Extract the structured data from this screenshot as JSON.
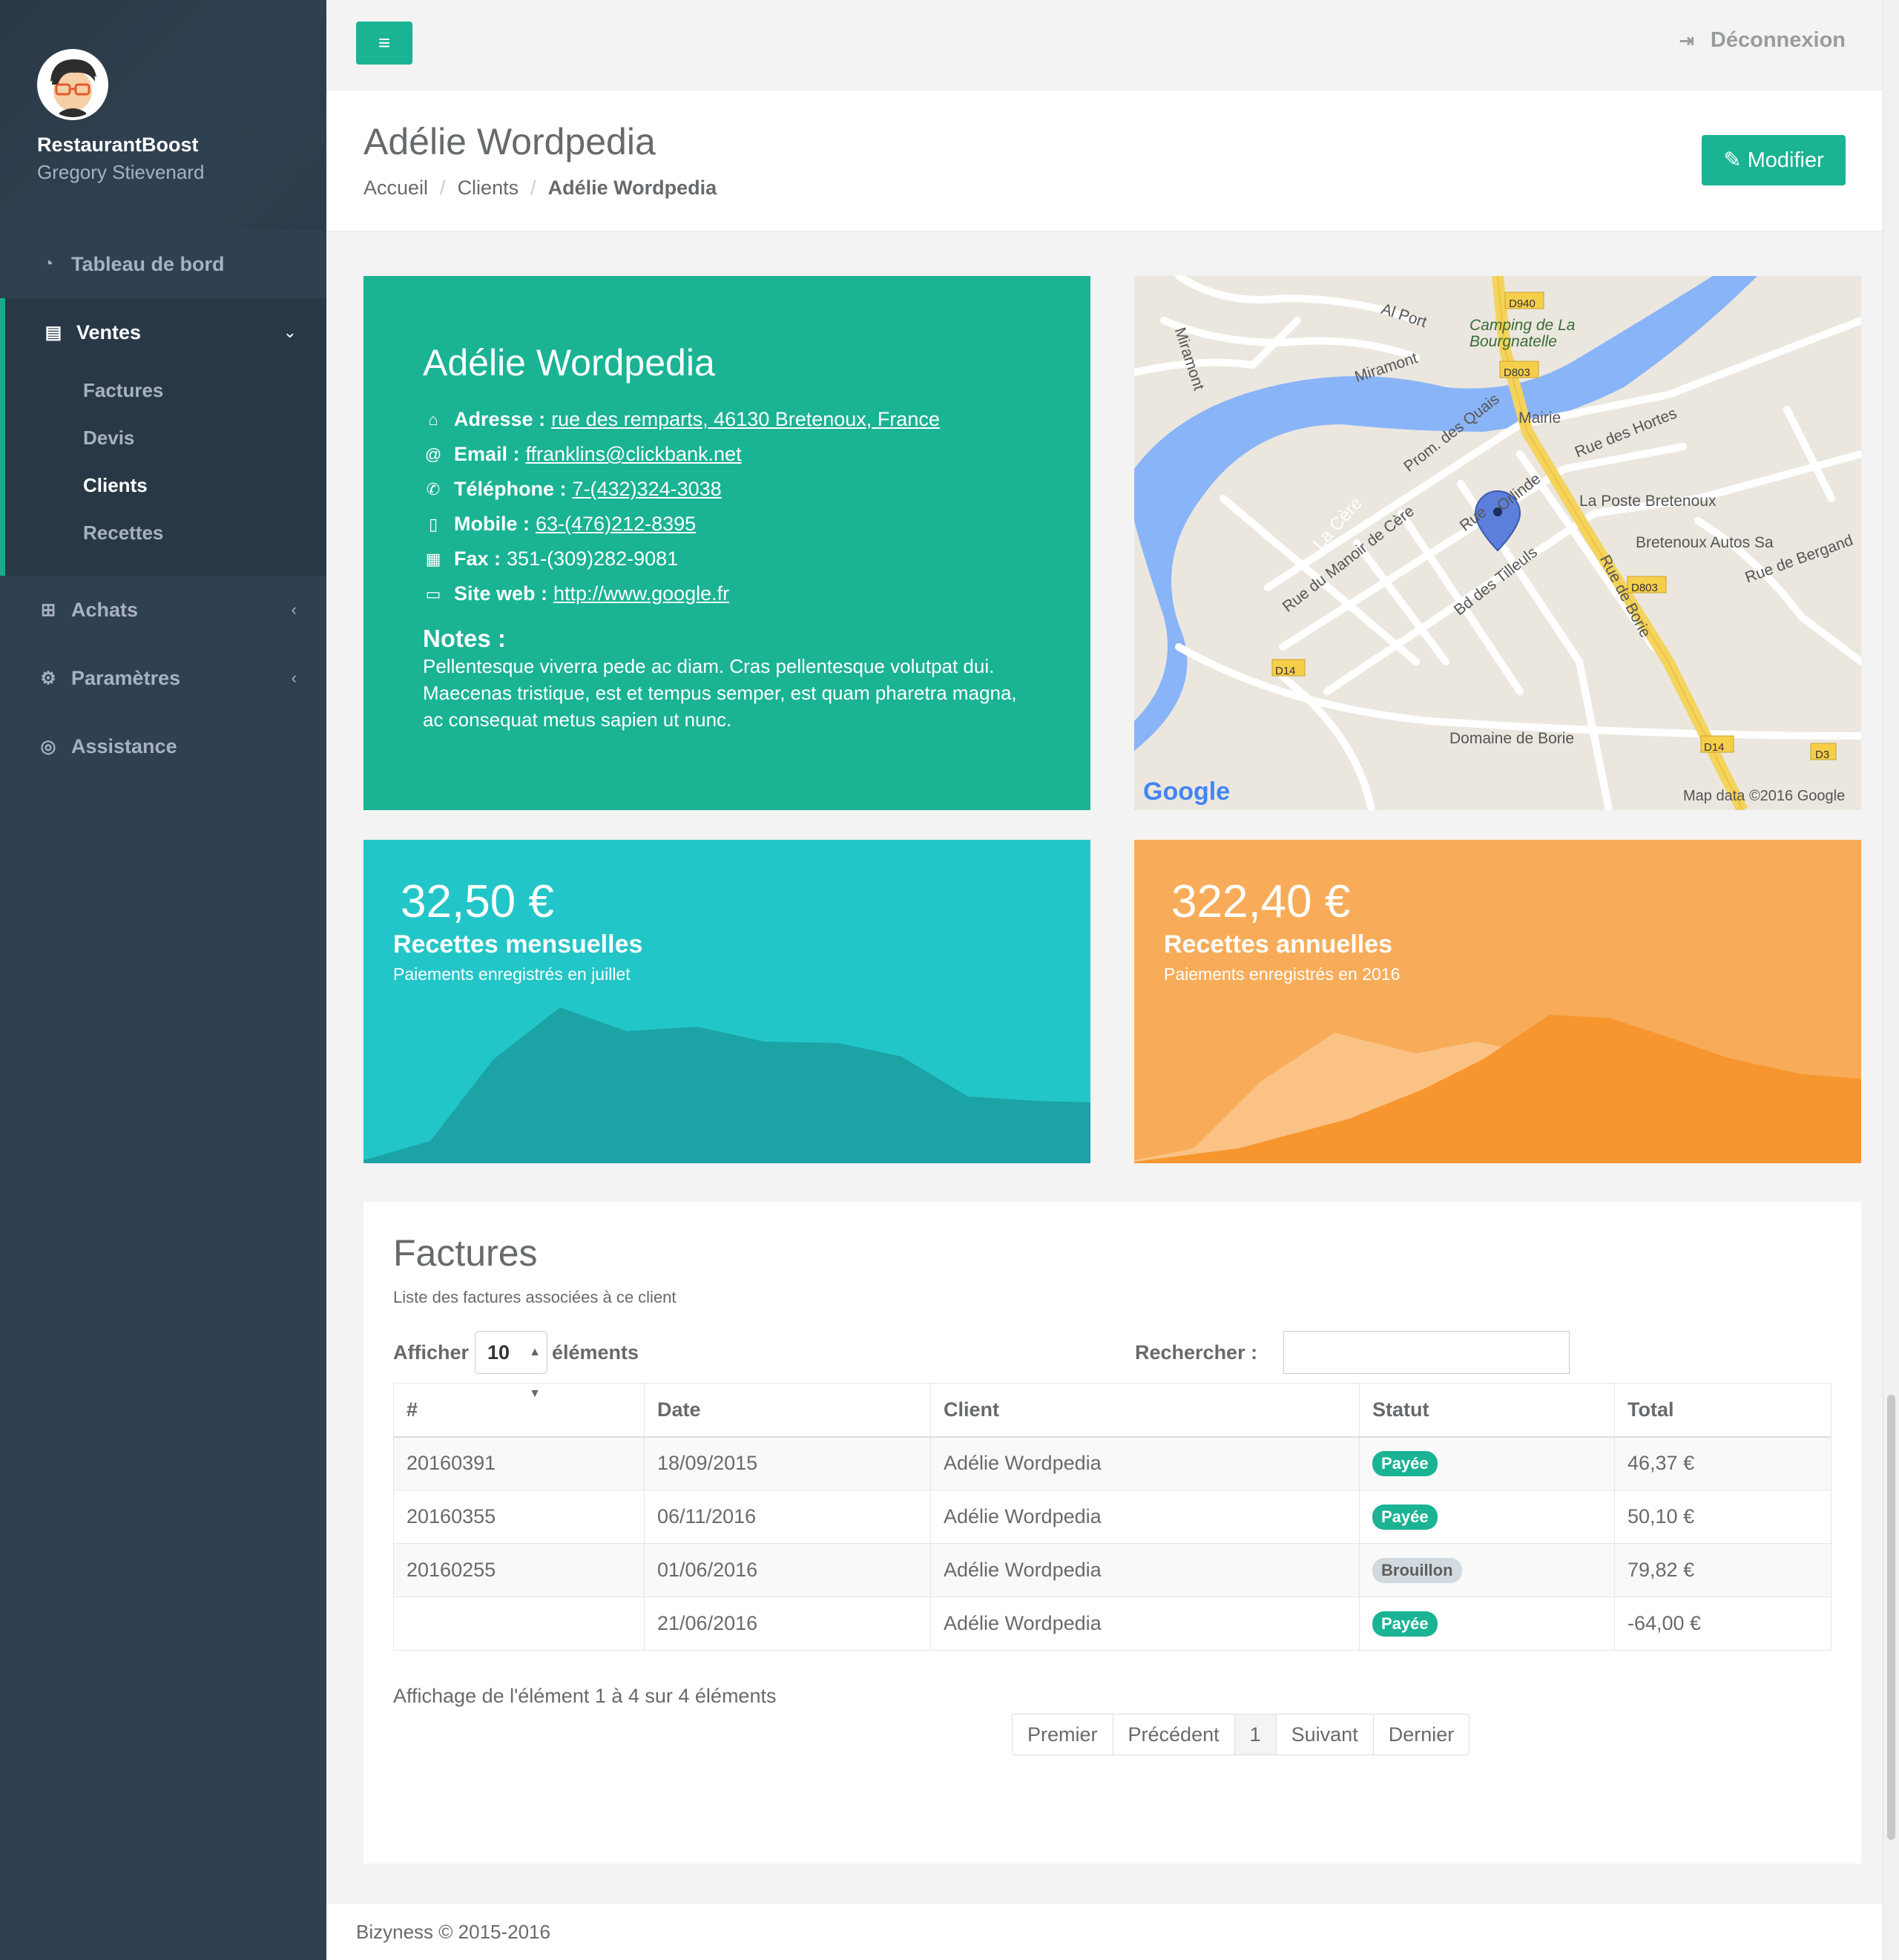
{
  "sidebar": {
    "brand": "RestaurantBoost",
    "user": "Gregory Stievenard",
    "dashboard": "Tableau de bord",
    "sales": "Ventes",
    "sales_items": [
      "Factures",
      "Devis",
      "Clients",
      "Recettes"
    ],
    "purchases": "Achats",
    "settings": "Paramètres",
    "support": "Assistance"
  },
  "topbar": {
    "logout": "Déconnexion"
  },
  "header": {
    "title": "Adélie Wordpedia",
    "breadcrumb": [
      "Accueil",
      "Clients",
      "Adélie Wordpedia"
    ],
    "edit_button": "Modifier"
  },
  "client": {
    "name": "Adélie Wordpedia",
    "address_label": "Adresse :",
    "address": "rue des remparts, 46130 Bretenoux, France",
    "email_label": "Email :",
    "email": "ffranklins@clickbank.net",
    "phone_label": "Téléphone :",
    "phone": "7-(432)324-3038",
    "mobile_label": "Mobile :",
    "mobile": "63-(476)212-8395",
    "fax_label": "Fax :",
    "fax": "351-(309)282-9081",
    "web_label": "Site web :",
    "web": "http://www.google.fr",
    "notes_label": "Notes :",
    "notes": "Pellentesque viverra pede ac diam. Cras pellentesque volutpat dui. Maecenas tristique, est et tempus semper, est quam pharetra magna, ac consequat metus sapien ut nunc."
  },
  "map": {
    "labels": {
      "al_port": "Al Port",
      "camping": "Camping de La Bourgnatelle",
      "miramont1": "Miramont",
      "miramont2": "Miramont",
      "prom": "Prom. des Quais",
      "mairie": "Mairie",
      "hortes": "Rue des Hortes",
      "cere": "La Cère",
      "manoir": "Rue du Manoir de Cère",
      "orlinde": "Orlinde",
      "rue": "Rue",
      "poste": "La Poste Bretenoux",
      "autos": "Bretenoux Autos Sa",
      "tilleuls": "Bd des Tilleuls",
      "borie_rue": "Rue de Borie",
      "bergand": "Rue de Bergand",
      "domaine": "Domaine de Borie",
      "google": "Google",
      "copyright": "Map data ©2016 Google",
      "d940": "D940",
      "d803a": "D803",
      "d803b": "D803",
      "d14a": "D14",
      "d14b": "D14",
      "d3": "D3"
    }
  },
  "monthly": {
    "amount": "32,50 €",
    "title": "Recettes mensuelles",
    "subtitle": "Paiements enregistrés en juillet",
    "color": "#23c6c8"
  },
  "yearly": {
    "amount": "322,40 €",
    "title": "Recettes annuelles",
    "subtitle": "Paiements enregistrés en 2016",
    "color": "#f8ac59"
  },
  "invoices": {
    "title": "Factures",
    "description": "Liste des factures associées à ce client",
    "show_label": "Afficher",
    "page_size": "10",
    "elements_label": "éléments",
    "search_label": "Rechercher :",
    "columns": [
      "#",
      "Date",
      "Client",
      "Statut",
      "Total"
    ],
    "rows": [
      {
        "num": "20160391",
        "date": "18/09/2015",
        "client": "Adélie Wordpedia",
        "status": "Payée",
        "total": "46,37 €"
      },
      {
        "num": "20160355",
        "date": "06/11/2016",
        "client": "Adélie Wordpedia",
        "status": "Payée",
        "total": "50,10 €"
      },
      {
        "num": "20160255",
        "date": "01/06/2016",
        "client": "Adélie Wordpedia",
        "status": "Brouillon",
        "total": "79,82 €"
      },
      {
        "num": "",
        "date": "21/06/2016",
        "client": "Adélie Wordpedia",
        "status": "Payée",
        "total": "-64,00 €"
      }
    ],
    "summary": "Affichage de l'élément 1 à 4 sur 4 éléments",
    "pager": [
      "Premier",
      "Précédent",
      "1",
      "Suivant",
      "Dernier"
    ]
  },
  "footer": {
    "text": "Bizyness © 2015-2016"
  }
}
